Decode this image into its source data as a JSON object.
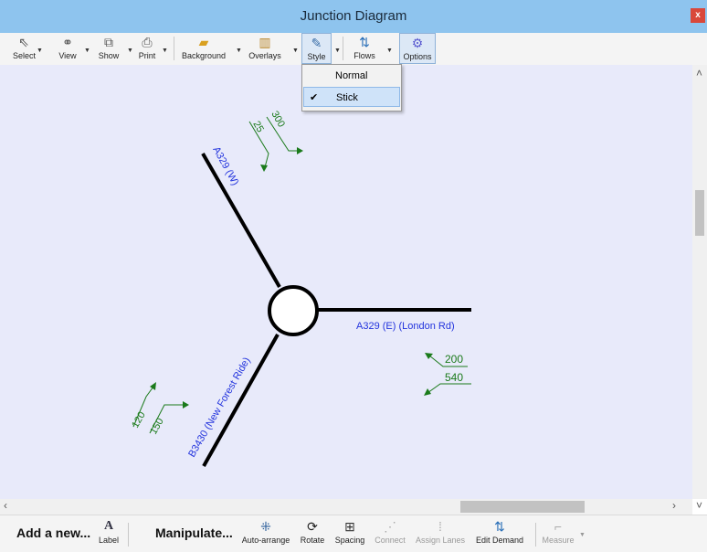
{
  "window": {
    "title": "Junction Diagram",
    "close_glyph": "x"
  },
  "toolbar": {
    "items": [
      {
        "label": "Select",
        "icon": "pointer-icon"
      },
      {
        "label": "View",
        "icon": "binoculars-icon"
      },
      {
        "label": "Show",
        "icon": "windows-icon"
      },
      {
        "label": "Print",
        "icon": "printer-icon"
      },
      {
        "label": "Background",
        "icon": "layers-icon"
      },
      {
        "label": "Overlays",
        "icon": "bar-chart-icon"
      },
      {
        "label": "Style",
        "icon": "paintbrush-icon"
      },
      {
        "label": "Flows",
        "icon": "flow-arrows-icon"
      },
      {
        "label": "Options",
        "icon": "gear-icon"
      }
    ]
  },
  "style_menu": {
    "items": [
      {
        "label": "Normal",
        "checked": false
      },
      {
        "label": "Stick",
        "checked": true
      }
    ]
  },
  "diagram": {
    "arms": [
      {
        "label": "A329 (W)",
        "color": "#2233dd"
      },
      {
        "label": "A329 (E) (London Rd)",
        "color": "#2233dd"
      },
      {
        "label": "B3430 (New Forest Ride)",
        "color": "#2233dd"
      }
    ],
    "flows": [
      {
        "arm": "A329 (W)",
        "in_value": "300",
        "out_value": "25"
      },
      {
        "arm": "A329 (E) (London Rd)",
        "in_value": "200",
        "out_value": "540"
      },
      {
        "arm": "B3430 (New Forest Ride)",
        "in_value": "120",
        "out_value": "150"
      }
    ],
    "flow_color": "#1a7a1a"
  },
  "bottom": {
    "add_heading": "Add a new...",
    "add_items": [
      {
        "label": "Label",
        "icon": "text-a-icon"
      }
    ],
    "manipulate_heading": "Manipulate...",
    "manipulate_items": [
      {
        "label": "Auto-arrange",
        "icon": "auto-arrange-icon",
        "enabled": true
      },
      {
        "label": "Rotate",
        "icon": "rotate-icon",
        "enabled": true
      },
      {
        "label": "Spacing",
        "icon": "spacing-icon",
        "enabled": true
      },
      {
        "label": "Connect",
        "icon": "connect-icon",
        "enabled": false
      },
      {
        "label": "Assign Lanes",
        "icon": "assign-lanes-icon",
        "enabled": false
      },
      {
        "label": "Edit Demand",
        "icon": "edit-demand-icon",
        "enabled": true
      },
      {
        "label": "Measure",
        "icon": "ruler-icon",
        "enabled": false
      }
    ]
  }
}
